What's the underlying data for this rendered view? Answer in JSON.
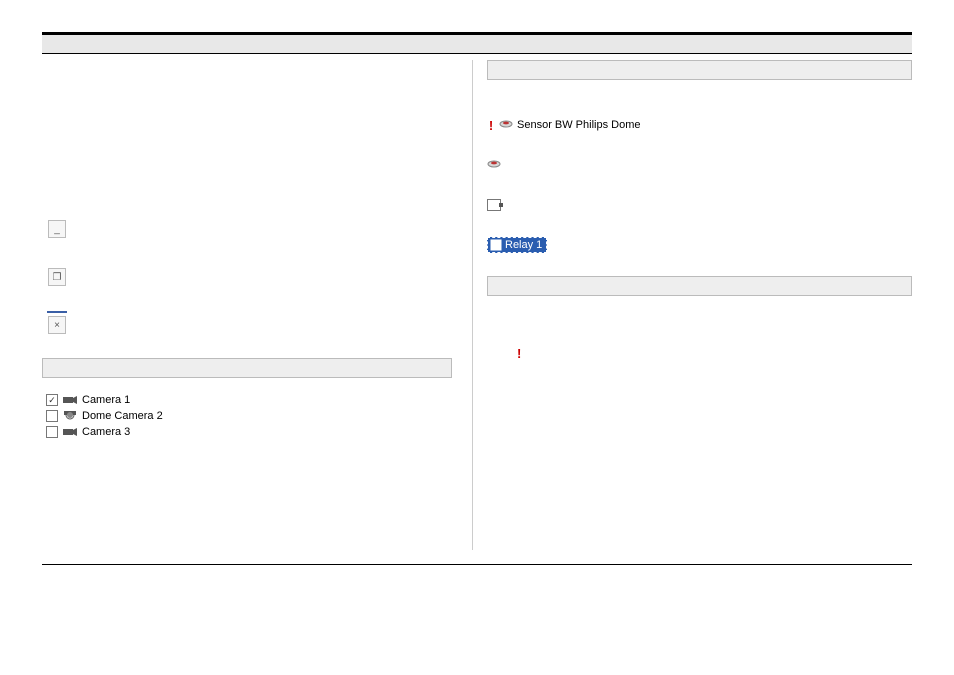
{
  "toolbar_buttons": {
    "minimize": "_",
    "restore": "❐",
    "close": "×"
  },
  "camera_list": [
    {
      "checked": true,
      "label": "Camera 1",
      "type": "fixed"
    },
    {
      "checked": false,
      "label": "Dome Camera 2",
      "type": "dome"
    },
    {
      "checked": false,
      "label": "Camera 3",
      "type": "fixed"
    }
  ],
  "device_tree": {
    "sensor_label": "Sensor BW Philips Dome",
    "relay_label": "Relay 1"
  },
  "alert_glyph": "!"
}
